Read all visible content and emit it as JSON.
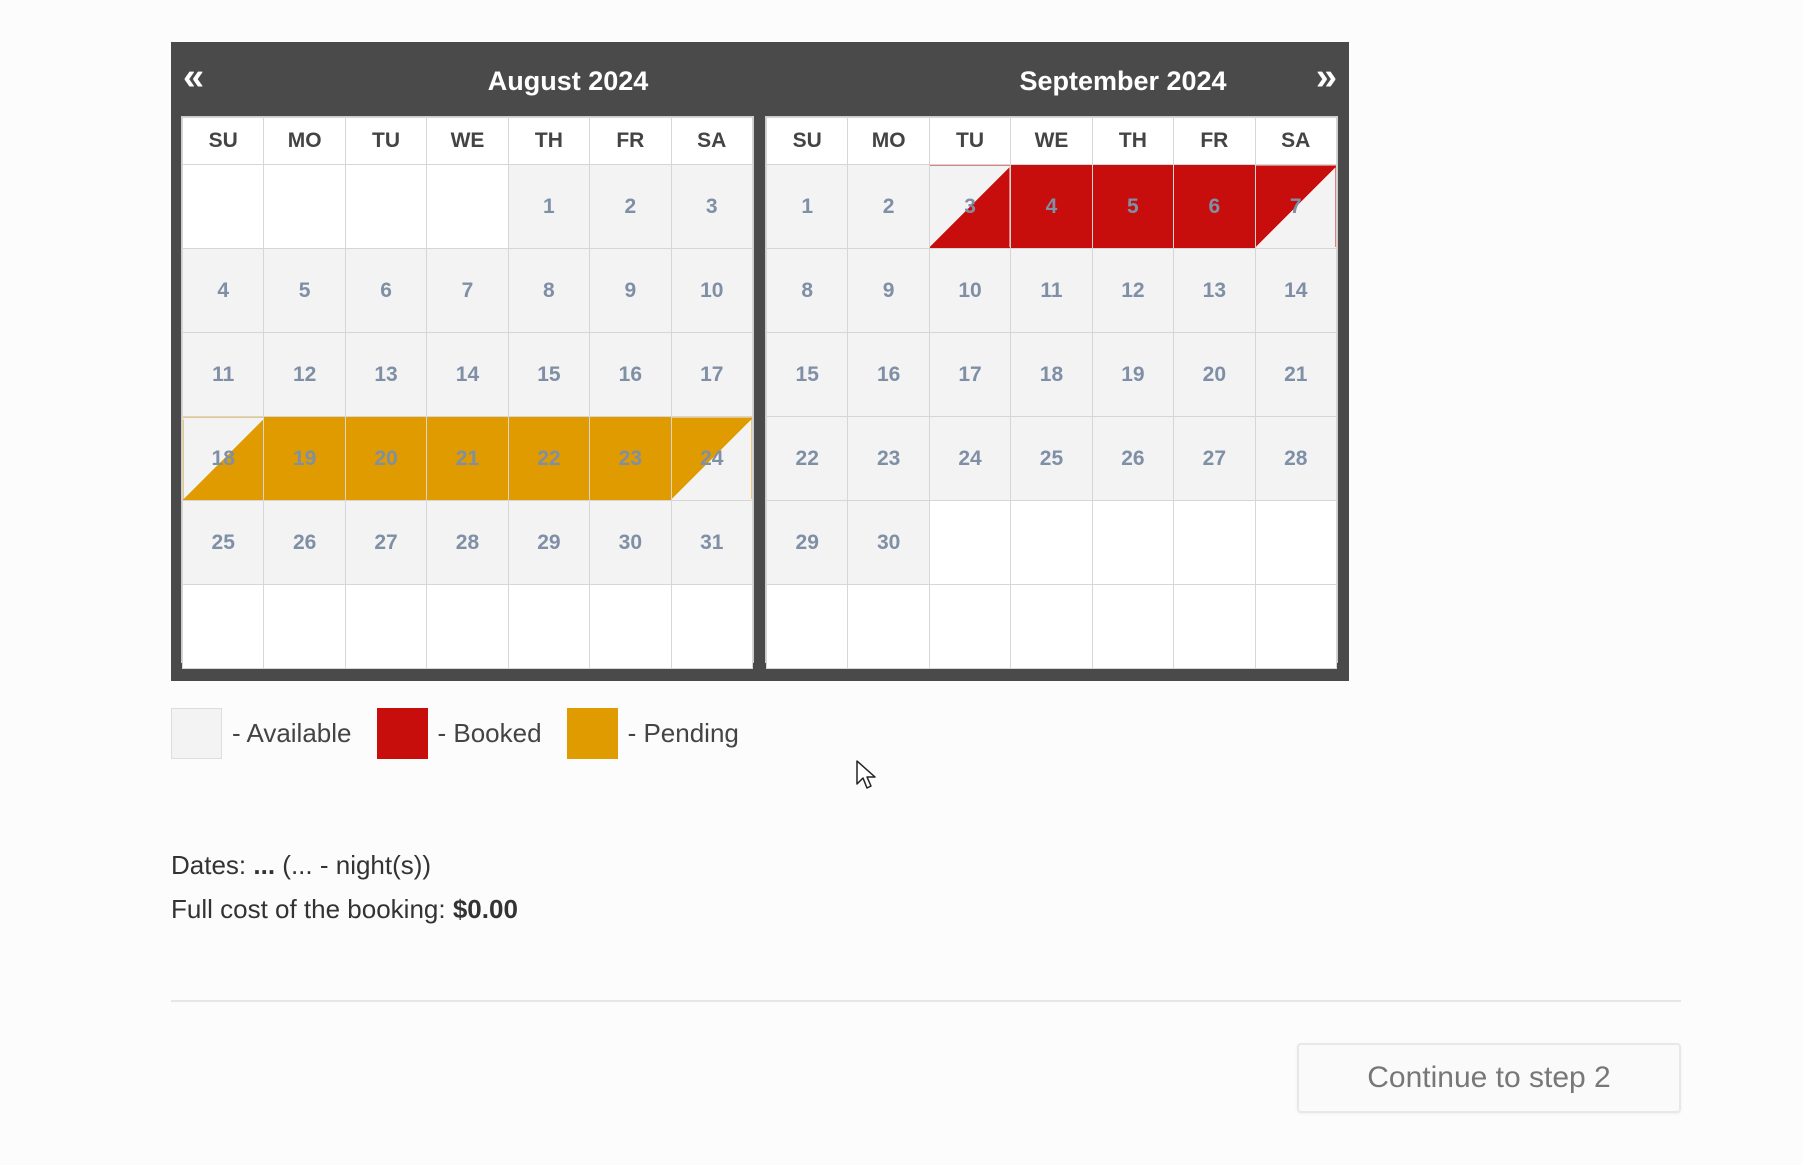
{
  "calendar": {
    "prev_icon": "«",
    "next_icon": "»",
    "months": [
      {
        "title": "August 2024",
        "weekdays": [
          "SU",
          "MO",
          "TU",
          "WE",
          "TH",
          "FR",
          "SA"
        ],
        "weeks": [
          [
            {
              "d": ""
            },
            {
              "d": ""
            },
            {
              "d": ""
            },
            {
              "d": ""
            },
            {
              "d": "1",
              "s": "available"
            },
            {
              "d": "2",
              "s": "available"
            },
            {
              "d": "3",
              "s": "available"
            }
          ],
          [
            {
              "d": "4",
              "s": "available"
            },
            {
              "d": "5",
              "s": "available"
            },
            {
              "d": "6",
              "s": "available"
            },
            {
              "d": "7",
              "s": "available"
            },
            {
              "d": "8",
              "s": "available"
            },
            {
              "d": "9",
              "s": "available"
            },
            {
              "d": "10",
              "s": "available"
            }
          ],
          [
            {
              "d": "11",
              "s": "available"
            },
            {
              "d": "12",
              "s": "available"
            },
            {
              "d": "13",
              "s": "available"
            },
            {
              "d": "14",
              "s": "available"
            },
            {
              "d": "15",
              "s": "available"
            },
            {
              "d": "16",
              "s": "available"
            },
            {
              "d": "17",
              "s": "available"
            }
          ],
          [
            {
              "d": "18",
              "s": "pending-start"
            },
            {
              "d": "19",
              "s": "pending"
            },
            {
              "d": "20",
              "s": "pending"
            },
            {
              "d": "21",
              "s": "pending"
            },
            {
              "d": "22",
              "s": "pending"
            },
            {
              "d": "23",
              "s": "pending"
            },
            {
              "d": "24",
              "s": "pending-end"
            }
          ],
          [
            {
              "d": "25",
              "s": "available"
            },
            {
              "d": "26",
              "s": "available"
            },
            {
              "d": "27",
              "s": "available"
            },
            {
              "d": "28",
              "s": "available"
            },
            {
              "d": "29",
              "s": "available"
            },
            {
              "d": "30",
              "s": "available"
            },
            {
              "d": "31",
              "s": "available"
            }
          ],
          [
            {
              "d": ""
            },
            {
              "d": ""
            },
            {
              "d": ""
            },
            {
              "d": ""
            },
            {
              "d": ""
            },
            {
              "d": ""
            },
            {
              "d": ""
            }
          ]
        ]
      },
      {
        "title": "September 2024",
        "weekdays": [
          "SU",
          "MO",
          "TU",
          "WE",
          "TH",
          "FR",
          "SA"
        ],
        "weeks": [
          [
            {
              "d": "1",
              "s": "available"
            },
            {
              "d": "2",
              "s": "available"
            },
            {
              "d": "3",
              "s": "booked-start"
            },
            {
              "d": "4",
              "s": "booked"
            },
            {
              "d": "5",
              "s": "booked"
            },
            {
              "d": "6",
              "s": "booked"
            },
            {
              "d": "7",
              "s": "booked-end"
            }
          ],
          [
            {
              "d": "8",
              "s": "available"
            },
            {
              "d": "9",
              "s": "available"
            },
            {
              "d": "10",
              "s": "available"
            },
            {
              "d": "11",
              "s": "available"
            },
            {
              "d": "12",
              "s": "available"
            },
            {
              "d": "13",
              "s": "available"
            },
            {
              "d": "14",
              "s": "available"
            }
          ],
          [
            {
              "d": "15",
              "s": "available"
            },
            {
              "d": "16",
              "s": "available"
            },
            {
              "d": "17",
              "s": "available"
            },
            {
              "d": "18",
              "s": "available"
            },
            {
              "d": "19",
              "s": "available"
            },
            {
              "d": "20",
              "s": "available"
            },
            {
              "d": "21",
              "s": "available"
            }
          ],
          [
            {
              "d": "22",
              "s": "available"
            },
            {
              "d": "23",
              "s": "available"
            },
            {
              "d": "24",
              "s": "available"
            },
            {
              "d": "25",
              "s": "available"
            },
            {
              "d": "26",
              "s": "available"
            },
            {
              "d": "27",
              "s": "available"
            },
            {
              "d": "28",
              "s": "available"
            }
          ],
          [
            {
              "d": "29",
              "s": "available"
            },
            {
              "d": "30",
              "s": "available"
            },
            {
              "d": ""
            },
            {
              "d": ""
            },
            {
              "d": ""
            },
            {
              "d": ""
            },
            {
              "d": ""
            }
          ],
          [
            {
              "d": ""
            },
            {
              "d": ""
            },
            {
              "d": ""
            },
            {
              "d": ""
            },
            {
              "d": ""
            },
            {
              "d": ""
            },
            {
              "d": ""
            }
          ]
        ]
      }
    ]
  },
  "legend": {
    "available": "- Available",
    "booked": "- Booked",
    "pending": "- Pending"
  },
  "info": {
    "dates_label": "Dates:",
    "dates_value": "...",
    "nights": "(... - night(s))",
    "cost_label": "Full cost of the booking:",
    "cost_value": "$0.00"
  },
  "actions": {
    "continue_label": "Continue to step 2"
  },
  "colors": {
    "available": "#f3f3f3",
    "booked": "#c80d0d",
    "pending": "#df9b00",
    "header": "#4a4a4a"
  }
}
